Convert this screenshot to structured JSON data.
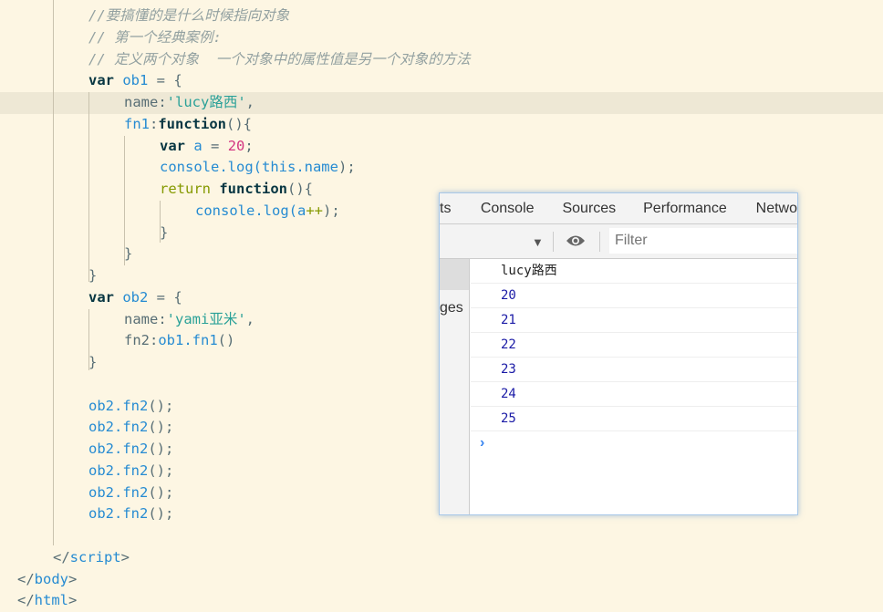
{
  "editor": {
    "lines": [
      {
        "indent": 2,
        "tokens": [
          [
            "//要搞懂的是什么时候指向对象",
            "cm"
          ]
        ]
      },
      {
        "indent": 2,
        "tokens": [
          [
            "// 第一个经典案例:",
            "cm"
          ]
        ]
      },
      {
        "indent": 2,
        "tokens": [
          [
            "// 定义两个对象  一个对象中的属性值是另一个对象的方法",
            "cm"
          ]
        ]
      },
      {
        "indent": 2,
        "tokens": [
          [
            "var",
            "kw"
          ],
          [
            " ",
            "pl"
          ],
          [
            "ob1",
            "id"
          ],
          [
            " = {",
            "pl"
          ]
        ]
      },
      {
        "indent": 3,
        "highlight": true,
        "tokens": [
          [
            "name:",
            "pl"
          ],
          [
            "'lucy路西'",
            "str"
          ],
          [
            ",",
            "pl"
          ]
        ]
      },
      {
        "indent": 3,
        "tokens": [
          [
            "fn1",
            "id"
          ],
          [
            ":",
            "pl"
          ],
          [
            "function",
            "kw"
          ],
          [
            "(){",
            "pl"
          ]
        ]
      },
      {
        "indent": 4,
        "tokens": [
          [
            "var",
            "kw"
          ],
          [
            " ",
            "pl"
          ],
          [
            "a",
            "id"
          ],
          [
            " = ",
            "pl"
          ],
          [
            "20",
            "num"
          ],
          [
            ";",
            "pl"
          ]
        ]
      },
      {
        "indent": 4,
        "tokens": [
          [
            "console.log(",
            "id"
          ],
          [
            "this",
            "id"
          ],
          [
            ".name",
            "id"
          ],
          [
            ");",
            "pl"
          ]
        ]
      },
      {
        "indent": 4,
        "tokens": [
          [
            "return",
            "ret"
          ],
          [
            " ",
            "pl"
          ],
          [
            "function",
            "kw"
          ],
          [
            "(){",
            "pl"
          ]
        ]
      },
      {
        "indent": 5,
        "tokens": [
          [
            "console.log(",
            "id"
          ],
          [
            "a",
            "id"
          ],
          [
            "++",
            "ret"
          ],
          [
            ");",
            "pl"
          ]
        ]
      },
      {
        "indent": 4,
        "tokens": [
          [
            "}",
            "pl"
          ]
        ]
      },
      {
        "indent": 3,
        "tokens": [
          [
            "}",
            "pl"
          ]
        ]
      },
      {
        "indent": 2,
        "tokens": [
          [
            "}",
            "pl"
          ]
        ]
      },
      {
        "indent": 2,
        "tokens": [
          [
            "var",
            "kw"
          ],
          [
            " ",
            "pl"
          ],
          [
            "ob2",
            "id"
          ],
          [
            " = {",
            "pl"
          ]
        ]
      },
      {
        "indent": 3,
        "tokens": [
          [
            "name:",
            "pl"
          ],
          [
            "'yami亚米'",
            "str"
          ],
          [
            ",",
            "pl"
          ]
        ]
      },
      {
        "indent": 3,
        "tokens": [
          [
            "fn2:",
            "pl"
          ],
          [
            "ob1.fn1",
            "id"
          ],
          [
            "()",
            "pl"
          ]
        ]
      },
      {
        "indent": 2,
        "tokens": [
          [
            "}",
            "pl"
          ]
        ]
      },
      {
        "indent": 2,
        "tokens": []
      },
      {
        "indent": 2,
        "tokens": [
          [
            "ob2.fn2",
            "id"
          ],
          [
            "();",
            "pl"
          ]
        ]
      },
      {
        "indent": 2,
        "tokens": [
          [
            "ob2.fn2",
            "id"
          ],
          [
            "();",
            "pl"
          ]
        ]
      },
      {
        "indent": 2,
        "tokens": [
          [
            "ob2.fn2",
            "id"
          ],
          [
            "();",
            "pl"
          ]
        ]
      },
      {
        "indent": 2,
        "tokens": [
          [
            "ob2.fn2",
            "id"
          ],
          [
            "();",
            "pl"
          ]
        ]
      },
      {
        "indent": 2,
        "tokens": [
          [
            "ob2.fn2",
            "id"
          ],
          [
            "();",
            "pl"
          ]
        ]
      },
      {
        "indent": 2,
        "tokens": [
          [
            "ob2.fn2",
            "id"
          ],
          [
            "();",
            "pl"
          ]
        ]
      },
      {
        "indent": 2,
        "tokens": []
      },
      {
        "indent": 1,
        "tokens": [
          [
            "</",
            "pl"
          ],
          [
            "script",
            "tag"
          ],
          [
            ">",
            "pl"
          ]
        ]
      },
      {
        "indent": 0,
        "tokens": [
          [
            "</",
            "pl"
          ],
          [
            "body",
            "tag"
          ],
          [
            ">",
            "pl"
          ]
        ]
      },
      {
        "indent": 0,
        "tokens": [
          [
            "</",
            "pl"
          ],
          [
            "html",
            "tag"
          ],
          [
            ">",
            "pl"
          ]
        ]
      }
    ]
  },
  "devtools": {
    "tabs": [
      "ts",
      "Console",
      "Sources",
      "Performance",
      "Netwo"
    ],
    "active_tab": "Console",
    "filter_placeholder": "Filter",
    "sidebar_label": "ges",
    "messages": [
      {
        "text": "lucy路西",
        "type": "string"
      },
      {
        "text": "20",
        "type": "number"
      },
      {
        "text": "21",
        "type": "number"
      },
      {
        "text": "22",
        "type": "number"
      },
      {
        "text": "23",
        "type": "number"
      },
      {
        "text": "24",
        "type": "number"
      },
      {
        "text": "25",
        "type": "number"
      }
    ],
    "prompt_icon": "chevron-right-icon",
    "colors": {
      "number": "#1a1aa6",
      "prompt": "#3a86f0",
      "editor_bg": "#fdf6e3"
    }
  }
}
